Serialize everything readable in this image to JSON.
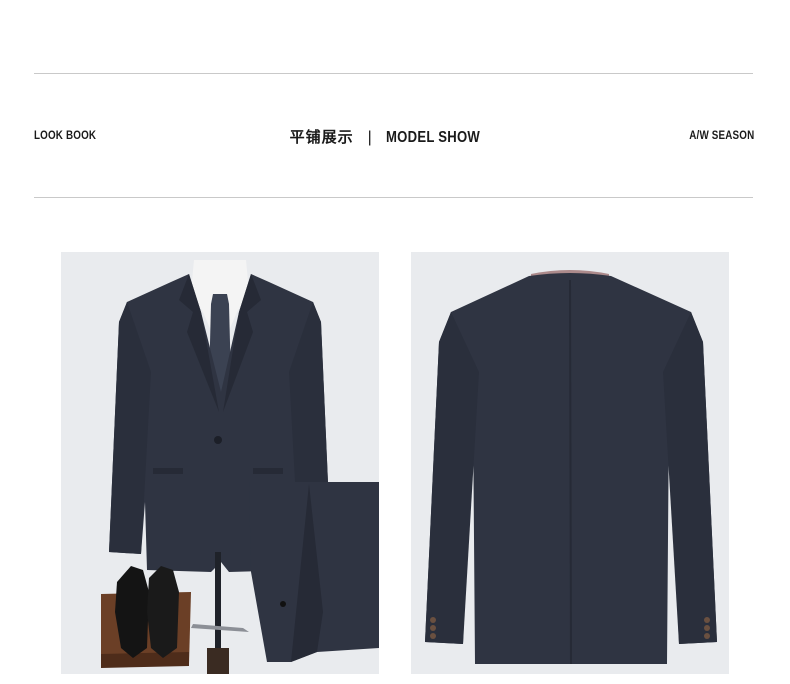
{
  "header": {
    "left_label": "LOOK BOOK",
    "center_cn": "平铺展示",
    "center_separator": "|",
    "center_en": "MODEL SHOW",
    "right_label": "A/W SEASON"
  },
  "images": {
    "front": {
      "subject": "navy suit jacket front with shirt, tie, trousers and black dress shoes on display stand"
    },
    "back": {
      "subject": "navy suit jacket back view"
    }
  },
  "colors": {
    "suit": "#2f3442",
    "suit_shadow": "#262a36",
    "background_panel": "#e9ebee",
    "rule": "#c9c9c9",
    "wood": "#6b3f26"
  }
}
